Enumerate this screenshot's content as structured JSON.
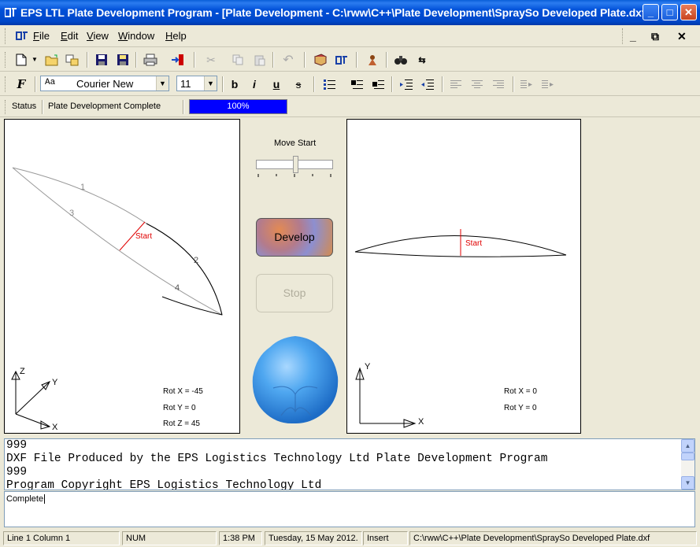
{
  "window": {
    "title": "EPS LTL Plate Development Program - [Plate Development - C:\\rww\\C++\\Plate Development\\SpraySo Developed Plate.dxf]",
    "minimize": "_",
    "maximize": "□",
    "close": "✕"
  },
  "menu": {
    "items": [
      "File",
      "Edit",
      "View",
      "Window",
      "Help"
    ],
    "mdi_min": "_",
    "mdi_restore": "⧉",
    "mdi_close": "✕"
  },
  "format": {
    "font_style_prefix": "Aa",
    "font_name": "Courier New",
    "font_size": "11",
    "bold": "b",
    "italic": "i",
    "underline": "u",
    "strike": "s"
  },
  "status": {
    "label": "Status",
    "message": "Plate Development Complete",
    "progress_text": "100%",
    "progress_value": 1.0,
    "progress_color": "#0000ff"
  },
  "left_view": {
    "point_labels": [
      "1",
      "2",
      "3",
      "4"
    ],
    "start_label": "Start",
    "axis_z": "Z",
    "axis_y": "Y",
    "axis_x": "X",
    "rot_x": "Rot X = -45",
    "rot_y": "Rot Y = 0",
    "rot_z": "Rot Z = 45"
  },
  "controls": {
    "move_start_label": "Move Start",
    "develop_label": "Develop",
    "stop_label": "Stop"
  },
  "right_view": {
    "start_label": "Start",
    "axis_y": "Y",
    "axis_x": "X",
    "rot_x": "Rot X = 0",
    "rot_y": "Rot Y = 0"
  },
  "output": {
    "lines": [
      "999",
      "DXF File Produced by the EPS Logistics Technology Ltd Plate Development Program",
      "999",
      "Program Copyright EPS Logistics Technology Ltd"
    ]
  },
  "command": {
    "text": "Complete"
  },
  "statusbar": {
    "position": "Line 1  Column 1",
    "num": "NUM",
    "time": "1:38 PM",
    "date": "Tuesday, 15 May 2012.",
    "mode": "Insert",
    "path": "C:\\rww\\C++\\Plate Development\\SpraySo Developed Plate.dxf"
  }
}
